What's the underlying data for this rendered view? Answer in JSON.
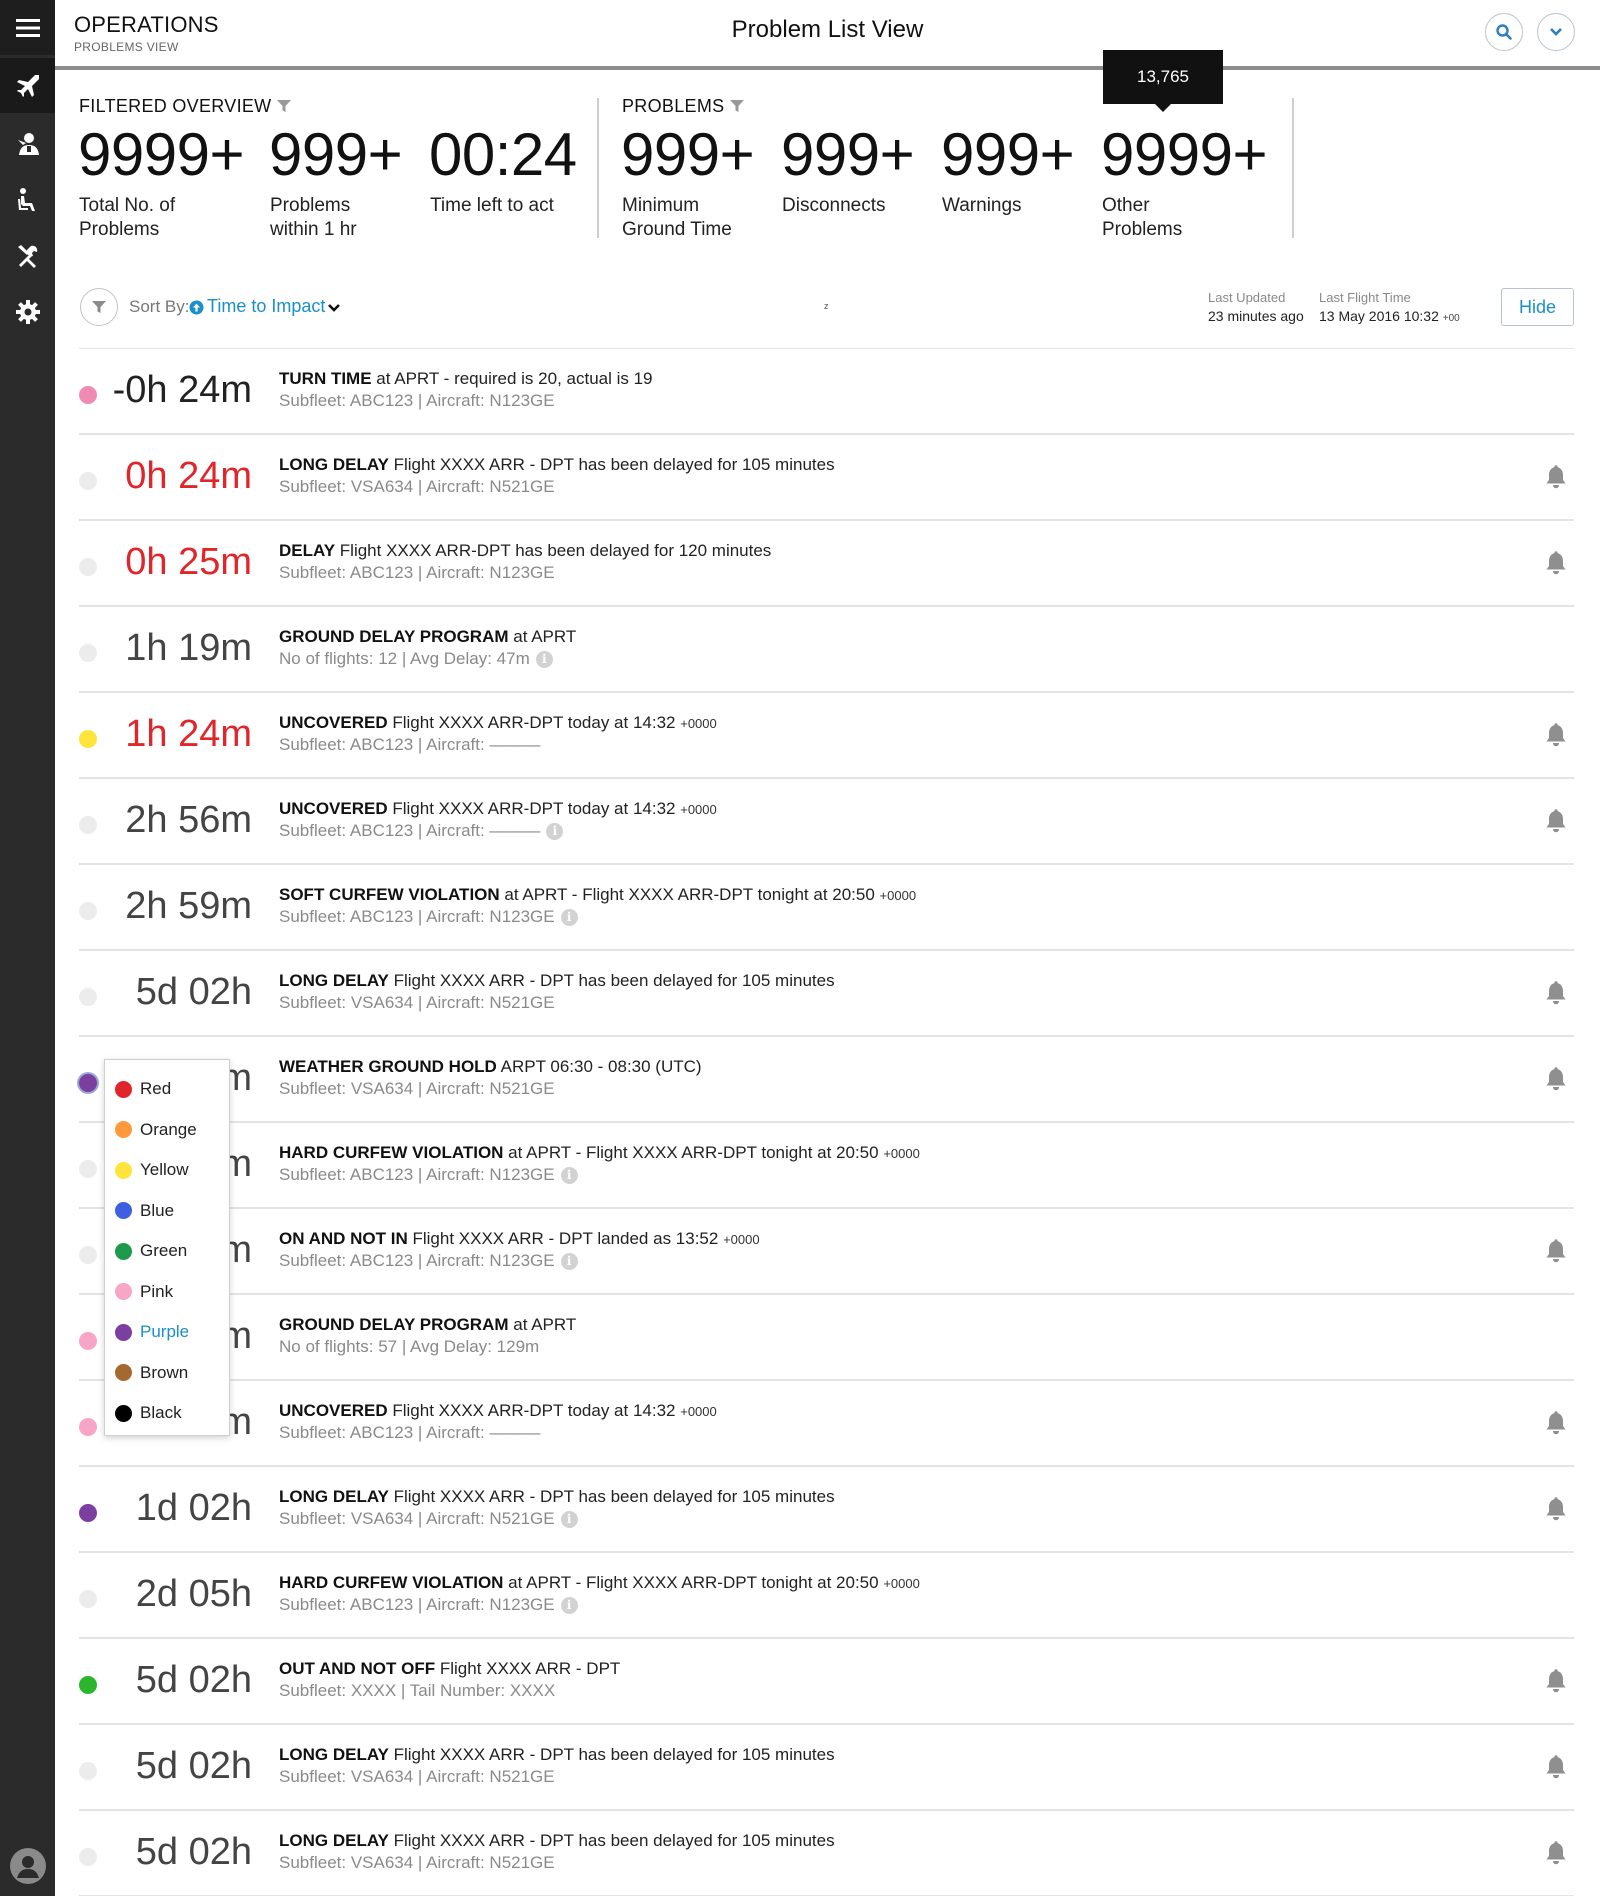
{
  "header": {
    "app_title": "OPERATIONS",
    "app_subtitle": "PROBLEMS VIEW",
    "page_title": "Problem List View"
  },
  "sidebar": {
    "items": [
      {
        "icon": "menu-icon"
      },
      {
        "icon": "airplane-icon",
        "active": true
      },
      {
        "icon": "crew-icon"
      },
      {
        "icon": "passenger-seat-icon"
      },
      {
        "icon": "maintenance-tools-icon"
      },
      {
        "icon": "settings-gear-icon"
      },
      {
        "icon": "user-avatar-icon"
      }
    ]
  },
  "tooltip": "13,765",
  "overview": {
    "filtered_label": "FILTERED OVERVIEW",
    "problems_label": "PROBLEMS",
    "total": {
      "value": "9999+",
      "label": [
        "Total No. of",
        "Problems"
      ]
    },
    "within_hr": {
      "value": "999+",
      "label": [
        "Problems",
        "within 1 hr"
      ]
    },
    "time_left": {
      "value": "00:24",
      "label": [
        "Time left to act"
      ]
    },
    "min_ground": {
      "value": "999+",
      "label": [
        "Minimum",
        "Ground Time"
      ]
    },
    "disconnects": {
      "value": "999+",
      "label": [
        "Disconnects"
      ]
    },
    "warnings": {
      "value": "999+",
      "label": [
        "Warnings"
      ]
    },
    "other": {
      "value": "9999+",
      "label": [
        "Other",
        "Problems"
      ]
    }
  },
  "sort": {
    "label": "Sort By:",
    "value": "Time to Impact",
    "stray_char": "z",
    "last_updated_label": "Last Updated",
    "last_updated_value": "23 minutes ago",
    "last_flight_label": "Last Flight Time",
    "last_flight_value": "13 May 2016 10:32",
    "last_flight_tz": "+00",
    "hide_label": "Hide"
  },
  "colors": {
    "red": "#e0262b",
    "orange": "#ff9a3c",
    "yellow": "#ffe53b",
    "blue": "#3f5fe0",
    "green": "#1e9a4c",
    "pink": "#f7a6c8",
    "purple": "#7b3fa0",
    "brown": "#a3692e",
    "black": "#000000"
  },
  "color_menu": {
    "options": [
      {
        "label": "Red",
        "color": "#e0262b"
      },
      {
        "label": "Orange",
        "color": "#ff9a3c"
      },
      {
        "label": "Yellow",
        "color": "#ffe53b"
      },
      {
        "label": "Blue",
        "color": "#3f5fe0"
      },
      {
        "label": "Green",
        "color": "#1e9a4c"
      },
      {
        "label": "Pink",
        "color": "#f7a6c8"
      },
      {
        "label": "Purple",
        "color": "#7b3fa0",
        "selected": true
      },
      {
        "label": "Brown",
        "color": "#a3692e"
      },
      {
        "label": "Black",
        "color": "#000000"
      }
    ]
  },
  "problems": [
    {
      "time": "-0h 24m",
      "time_color": "dark",
      "dot": "#f08cb4",
      "title": "TURN TIME",
      "desc": " at APRT - required is 20, actual is 19",
      "suffix": "",
      "sub": "Subfleet: ABC123 | Aircraft: N123GE",
      "info": false,
      "bell": false
    },
    {
      "time": "0h 24m",
      "time_color": "red",
      "dot": "#ececec",
      "title": "LONG DELAY",
      "desc": " Flight XXXX ARR - DPT has been delayed for 105 minutes",
      "suffix": "",
      "sub": "Subfleet: VSA634 | Aircraft: N521GE",
      "info": false,
      "bell": true
    },
    {
      "time": "0h 25m",
      "time_color": "red",
      "dot": "#ececec",
      "title": "DELAY",
      "desc": " Flight XXXX ARR-DPT has been delayed for 120 minutes",
      "suffix": "",
      "sub": "Subfleet: ABC123 | Aircraft: N123GE",
      "info": false,
      "bell": true
    },
    {
      "time": "1h 19m",
      "time_color": "grey",
      "dot": "#ececec",
      "title": "GROUND DELAY PROGRAM",
      "desc": " at APRT",
      "suffix": "",
      "sub": "No of flights: 12 | Avg Delay: 47m",
      "info": true,
      "bell": false
    },
    {
      "time": "1h 24m",
      "time_color": "red",
      "dot": "#ffe53b",
      "title": "UNCOVERED",
      "desc": " Flight XXXX ARR-DPT today at 14:32 ",
      "suffix": "+0000",
      "sub": "Subfleet: ABC123 | Aircraft: ———",
      "info": false,
      "bell": true
    },
    {
      "time": "2h 56m",
      "time_color": "grey",
      "dot": "#ececec",
      "title": "UNCOVERED",
      "desc": " Flight XXXX ARR-DPT today at 14:32 ",
      "suffix": "+0000",
      "sub": "Subfleet: ABC123 | Aircraft: ———",
      "info": true,
      "bell": true
    },
    {
      "time": "2h 59m",
      "time_color": "grey",
      "dot": "#ececec",
      "title": "SOFT CURFEW VIOLATION",
      "desc": " at APRT - Flight XXXX ARR-DPT tonight at 20:50 ",
      "suffix": "+0000",
      "sub": "Subfleet: ABC123 | Aircraft: N123GE",
      "info": true,
      "bell": false
    },
    {
      "time": "5d 02h",
      "time_color": "grey",
      "dot": "#ececec",
      "title": "LONG DELAY",
      "desc": " Flight XXXX ARR - DPT has been delayed for 105 minutes",
      "suffix": "",
      "sub": "Subfleet: VSA634 | Aircraft: N521GE",
      "info": false,
      "bell": true
    },
    {
      "time": "m",
      "time_color": "grey",
      "dot": "#7b3fa0",
      "selected": true,
      "title": "WEATHER GROUND HOLD",
      "desc": " ARPT 06:30 - 08:30 (UTC)",
      "suffix": "",
      "sub": "Subfleet: VSA634 | Aircraft: N521GE",
      "info": false,
      "bell": true
    },
    {
      "time": "m",
      "time_color": "grey",
      "dot": "#ececec",
      "title": "HARD CURFEW VIOLATION",
      "desc": " at APRT - Flight XXXX ARR-DPT tonight at 20:50 ",
      "suffix": "+0000",
      "sub": "Subfleet: ABC123 | Aircraft: N123GE",
      "info": true,
      "bell": false
    },
    {
      "time": "m",
      "time_color": "grey",
      "dot": "#ececec",
      "title": "ON AND NOT IN",
      "desc": " Flight XXXX ARR - DPT landed as 13:52 ",
      "suffix": "+0000",
      "sub": "Subfleet: ABC123 | Aircraft: N123GE",
      "info": true,
      "bell": true
    },
    {
      "time": "m",
      "time_color": "grey",
      "dot": "#f7a6c8",
      "title": "GROUND DELAY PROGRAM",
      "desc": " at APRT",
      "suffix": "",
      "sub": "No of flights: 57 | Avg Delay: 129m",
      "info": false,
      "bell": false
    },
    {
      "time": "m",
      "time_color": "grey",
      "dot": "#f7a6c8",
      "title": "UNCOVERED",
      "desc": " Flight XXXX ARR-DPT today at 14:32 ",
      "suffix": "+0000",
      "sub": "Subfleet: ABC123 | Aircraft: ———",
      "info": false,
      "bell": true
    },
    {
      "time": "1d 02h",
      "time_color": "grey",
      "dot": "#7b3fa0",
      "title": "LONG DELAY",
      "desc": " Flight XXXX ARR - DPT has been delayed for 105 minutes",
      "suffix": "",
      "sub": "Subfleet: VSA634 | Aircraft: N521GE",
      "info": true,
      "bell": true
    },
    {
      "time": "2d 05h",
      "time_color": "grey",
      "dot": "#ececec",
      "title": "HARD CURFEW VIOLATION",
      "desc": " at APRT - Flight XXXX ARR-DPT tonight at 20:50 ",
      "suffix": "+0000",
      "sub": "Subfleet: ABC123 | Aircraft: N123GE",
      "info": true,
      "bell": false
    },
    {
      "time": "5d 02h",
      "time_color": "grey",
      "dot": "#2db52d",
      "title": "OUT AND NOT OFF",
      "desc": " Flight XXXX ARR - DPT",
      "suffix": "",
      "sub": "Subfleet: XXXX | Tail Number: XXXX",
      "info": false,
      "bell": true
    },
    {
      "time": "5d 02h",
      "time_color": "grey",
      "dot": "#ececec",
      "title": "LONG DELAY",
      "desc": " Flight XXXX ARR - DPT has been delayed for 105 minutes",
      "suffix": "",
      "sub": "Subfleet: VSA634 | Aircraft: N521GE",
      "info": false,
      "bell": true
    },
    {
      "time": "5d 02h",
      "time_color": "grey",
      "dot": "#ececec",
      "title": "LONG DELAY",
      "desc": " Flight XXXX ARR - DPT has been delayed for 105 minutes",
      "suffix": "",
      "sub": "Subfleet: VSA634 | Aircraft: N521GE",
      "info": false,
      "bell": true
    }
  ]
}
